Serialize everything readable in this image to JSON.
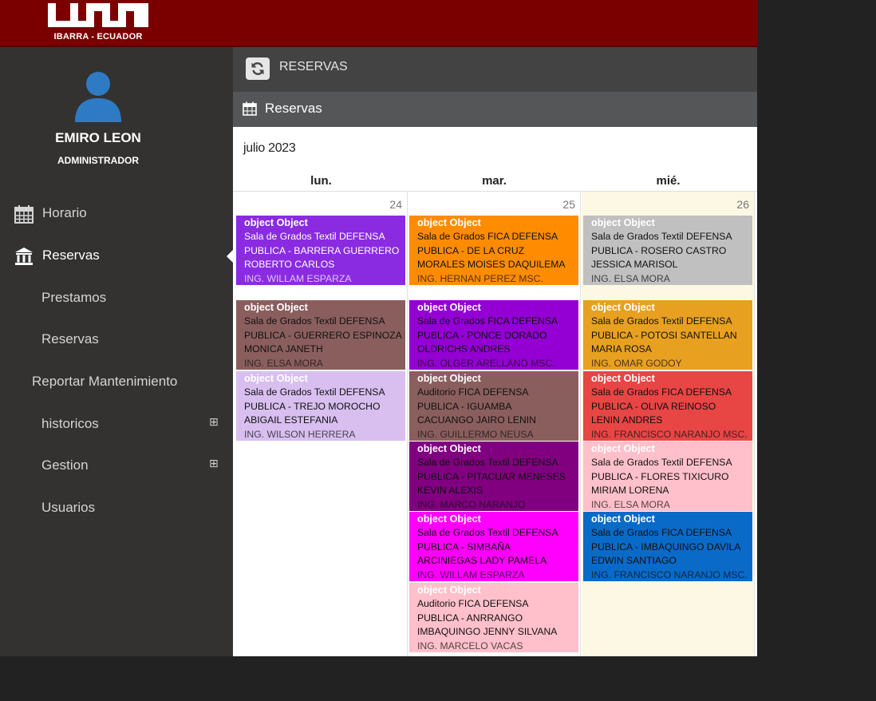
{
  "header": {
    "logo_text": "IBARRA - ECUADOR",
    "logo_letters": "UTN",
    "brand_color": "#7a0000"
  },
  "sidebar": {
    "user_name": "EMIRO LEON",
    "user_role": "ADMINISTRADOR",
    "items": [
      {
        "label": "Horario",
        "icon": "calendar-grid-icon"
      },
      {
        "label": "Reservas",
        "icon": "bank-building-icon"
      },
      {
        "label": "Prestamos"
      },
      {
        "label": "Reservas"
      },
      {
        "label": "Reportar Mantenimiento"
      },
      {
        "label": "historicos",
        "expander": "⊞"
      },
      {
        "label": "Gestion",
        "expander": "⊞"
      },
      {
        "label": "Usuarios"
      }
    ]
  },
  "breadcrumb": {
    "title": "RESERVAS"
  },
  "panel": {
    "title": "Reservas"
  },
  "calendar": {
    "month": "julio 2023",
    "days": [
      {
        "header": "lun.",
        "number": "24",
        "background": "#ffffff",
        "events": [
          {
            "title": "object Object",
            "line1": "Sala de Grados Textil DEFENSA",
            "line2": "PUBLICA - BARRERA GUERRERO",
            "line3": "ROBERTO CARLOS",
            "tutor": "ING. WILLAM ESPARZA",
            "color": "#8a2be2",
            "text_color": "#ffffff"
          },
          {
            "title": "object Object",
            "line1": "Sala de Grados Textil DEFENSA",
            "line2": "PUBLICA - GUERRERO ESPINOZA",
            "line3": "MONICA JANETH",
            "tutor": "ING. ELSA MORA",
            "color": "#8b5e5e",
            "text_color": "#111111"
          },
          {
            "title": "object Object",
            "line1": "Sala de Grados Textil DEFENSA",
            "line2": "PUBLICA - TREJO MOROCHO",
            "line3": "ABIGAIL ESTEFANIA",
            "tutor": "ING. WILSON HERRERA",
            "color": "#d8bff0",
            "text_color": "#111111"
          }
        ]
      },
      {
        "header": "mar.",
        "number": "25",
        "background": "#ffffff",
        "events": [
          {
            "title": "object Object",
            "line1": "Sala de Grados FICA DEFENSA",
            "line2": "PUBLICA - DE LA CRUZ",
            "line3": "MORALES MOISES DAQUILEMA",
            "tutor": "ING. HERNAN PEREZ MSC.",
            "color": "#ff8c00",
            "text_color": "#111111"
          },
          {
            "title": "object Object",
            "line1": "Sala de Grados FICA DEFENSA",
            "line2": "PUBLICA - PONCE DORADO",
            "line3": "OLDRICHS ANDRES",
            "tutor": "ING. OLGER ARELLANO MSC.",
            "color": "#9400d3",
            "text_color": "#111111"
          },
          {
            "title": "object Object",
            "line1": "Auditorio FICA DEFENSA",
            "line2": "PUBLICA - IGUAMBA",
            "line3": "CACUANGO JAIRO LENIN",
            "tutor": "ING. GUILLERMO NEUSA",
            "color": "#8b5e5e",
            "text_color": "#111111"
          },
          {
            "title": "object Object",
            "line1": "Sala de Grados Textil DEFENSA",
            "line2": "PUBLICA - PITACUAR MENESES",
            "line3": "KEVIN ALEXIS",
            "tutor": "ING. MARCO NARANJO",
            "color": "#800080",
            "text_color": "#111111"
          },
          {
            "title": "object Object",
            "line1": "Sala de Grados Textil DEFENSA",
            "line2": "PUBLICA - SIMBAÑA",
            "line3": "ARCINIEGAS LADY PAMELA",
            "tutor": "ING. WILLAM ESPARZA",
            "color": "#ff00ff",
            "text_color": "#111111"
          },
          {
            "title": "object Object",
            "line1": "Auditorio FICA DEFENSA",
            "line2": "PUBLICA - ANRRANGO",
            "line3": "IMBAQUINGO JENNY SILVANA",
            "tutor": "ING. MARCELO VACAS",
            "color": "#ffc0cb",
            "text_color": "#111111"
          }
        ]
      },
      {
        "header": "mié.",
        "number": "26",
        "background": "#fcf8e3",
        "events": [
          {
            "title": "object Object",
            "line1": "Sala de Grados Textil DEFENSA",
            "line2": "PUBLICA - ROSERO CASTRO",
            "line3": "JESSICA MARISOL",
            "tutor": "ING. ELSA MORA",
            "color": "#c0c0c0",
            "text_color": "#111111"
          },
          {
            "title": "object Object",
            "line1": "Sala de Grados Textil DEFENSA",
            "line2": "PUBLICA - POTOSI SANTELLAN",
            "line3": "MARIA ROSA",
            "tutor": "ING. OMAR GODOY",
            "color": "#e8a020",
            "text_color": "#111111"
          },
          {
            "title": "object Object",
            "line1": "Sala de Grados FICA DEFENSA",
            "line2": "PUBLICA - OLIVA REINOSO",
            "line3": "LENIN ANDRES",
            "tutor": "ING. FRANCISCO NARANJO MSC.",
            "color": "#e84545",
            "text_color": "#111111"
          },
          {
            "title": "object Object",
            "line1": "Sala de Grados Textil DEFENSA",
            "line2": "PUBLICA - FLORES TIXICURO",
            "line3": "MIRIAM LORENA",
            "tutor": "ING. ELSA MORA",
            "color": "#ffc0cb",
            "text_color": "#111111"
          },
          {
            "title": "object Object",
            "line1": "Sala de Grados FICA DEFENSA",
            "line2": "PUBLICA - IMBAQUINGO DAVILA",
            "line3": "EDWIN SANTIAGO",
            "tutor": "ING. FRANCISCO NARANJO MSC.",
            "color": "#0a6ac8",
            "text_color": "#111111"
          }
        ]
      }
    ]
  }
}
